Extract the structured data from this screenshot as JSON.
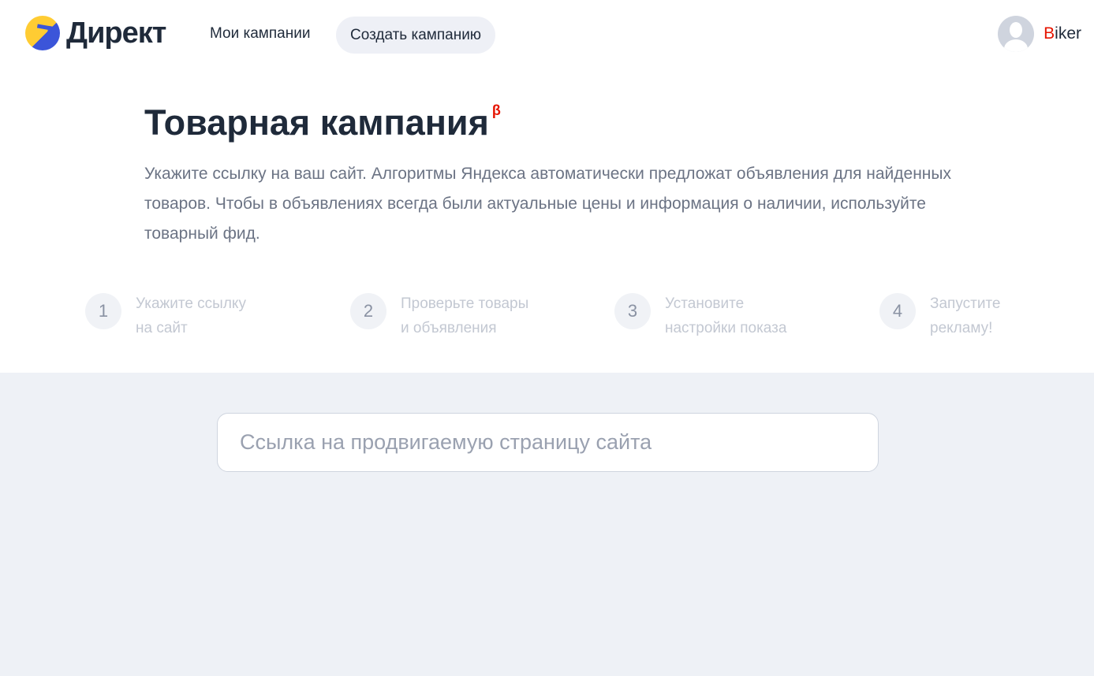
{
  "header": {
    "logo_text": "Директ",
    "nav_my": "Мои кампании",
    "nav_create": "Создать кампанию",
    "user_initial": "B",
    "user_rest": "iker"
  },
  "main": {
    "title": "Товарная кампания",
    "beta": "β",
    "description": "Укажите ссылку на ваш сайт. Алгоритмы Яндекса автоматически предложат объявления для найденных товаров. Чтобы в объявлениях всегда были актуальные цены и информация о наличии, используйте товарный фид."
  },
  "steps": [
    {
      "num": "1",
      "line1": "Укажите ссылку",
      "line2": "на сайт"
    },
    {
      "num": "2",
      "line1": "Проверьте товары",
      "line2": "и объявления"
    },
    {
      "num": "3",
      "line1": "Установите",
      "line2": "настройки показа"
    },
    {
      "num": "4",
      "line1": "Запустите",
      "line2": "рекламу!"
    }
  ],
  "form": {
    "url_placeholder": "Ссылка на продвигаемую страницу сайта",
    "url_value": ""
  }
}
